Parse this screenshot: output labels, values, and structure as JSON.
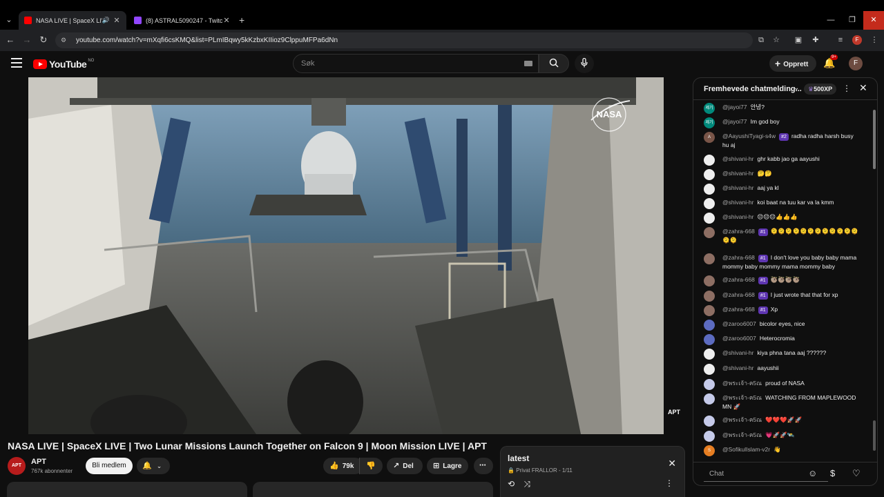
{
  "browser": {
    "tabs": [
      {
        "title": "NASA LIVE | SpaceX LIVE | Tw",
        "active": true,
        "favicon_color": "#ff0000"
      },
      {
        "title": "(8) ASTRAL5090247 - Twitch",
        "active": false,
        "favicon_color": "#9146ff"
      }
    ],
    "url": "youtube.com/watch?v=mXqfi6csKMQ&list=PLmIBqwy5kKzbxKIIioz9ClppuMFPa6dNn",
    "profile_initial": "F",
    "icons": [
      "back-icon",
      "forward-icon",
      "reload-icon",
      "site-info-icon",
      "install-icon",
      "star-icon",
      "extension-icon",
      "puzzle-icon",
      "media-icon",
      "menu-icon"
    ]
  },
  "youtube": {
    "logo_text": "YouTube",
    "country_code": "NO",
    "search_placeholder": "Søk",
    "create_label": "Opprett",
    "notifications_badge": "9+",
    "avatar_initial": "F"
  },
  "video": {
    "title": "NASA LIVE | SpaceX LIVE | Two Lunar Missions Launch Together on Falcon 9 | Moon Mission LIVE | APT",
    "watermark_logo": "NASA",
    "corner_logo": "APT"
  },
  "channel": {
    "name": "APT",
    "subscribers": "767k abonnenter",
    "avatar_text": "APT",
    "member_button": "Bli medlem"
  },
  "actions": {
    "likes": "79k",
    "share": "Del",
    "save": "Lagre"
  },
  "playlist": {
    "title": "latest",
    "privacy": "Privat",
    "owner_progress": "FRALLOR - 1/11"
  },
  "chat": {
    "header": "Fremhevede chatmelding...",
    "xp": "500XP",
    "input_placeholder": "Chat",
    "messages": [
      {
        "author": "@jayoi77",
        "badge": "",
        "text": "안녕?",
        "avatar_color": "#00897b",
        "avatar_text": "제기"
      },
      {
        "author": "@jayoi77",
        "badge": "",
        "text": "Im god boy",
        "avatar_color": "#00897b",
        "avatar_text": "제기"
      },
      {
        "author": "@AayushiTyagi-s4w",
        "badge": "#2",
        "text": "radha radha harsh busy hu aj",
        "avatar_color": "#795548",
        "avatar_text": "A"
      },
      {
        "author": "@shivani-hr",
        "badge": "",
        "text": "ghr kabb jao ga aayushi",
        "avatar_color": "#eeeeee",
        "avatar_text": ""
      },
      {
        "author": "@shivani-hr",
        "badge": "",
        "text": "🤔🤔",
        "avatar_color": "#eeeeee",
        "avatar_text": ""
      },
      {
        "author": "@shivani-hr",
        "badge": "",
        "text": "aaj ya kl",
        "avatar_color": "#eeeeee",
        "avatar_text": ""
      },
      {
        "author": "@shivani-hr",
        "badge": "",
        "text": "koi baat na tuu kar va la kmm",
        "avatar_color": "#eeeeee",
        "avatar_text": ""
      },
      {
        "author": "@shivani-hr",
        "badge": "",
        "text": "😌😌😌👍👍👍",
        "avatar_color": "#eeeeee",
        "avatar_text": ""
      },
      {
        "author": "@zahra-668",
        "badge": "#1",
        "text": "🫠🫠🫠🫠🫠🫠🫠🫠🫠🫠🫠🫠🫠🫠",
        "avatar_color": "#8d6e63",
        "avatar_text": ""
      },
      {
        "author": "@zahra-668",
        "badge": "#1",
        "text": "I don't love you baby baby mama mommy baby mommy mama mommy baby",
        "avatar_color": "#8d6e63",
        "avatar_text": ""
      },
      {
        "author": "@zahra-668",
        "badge": "#1",
        "text": "🦥🦥🦥🦥",
        "avatar_color": "#8d6e63",
        "avatar_text": ""
      },
      {
        "author": "@zahra-668",
        "badge": "#1",
        "text": "I just wrote that that for xp",
        "avatar_color": "#8d6e63",
        "avatar_text": ""
      },
      {
        "author": "@zahra-668",
        "badge": "#1",
        "text": "Xp",
        "avatar_color": "#8d6e63",
        "avatar_text": ""
      },
      {
        "author": "@zaroo6007",
        "badge": "",
        "text": "bicolor eyes, nice",
        "avatar_color": "#5c6bc0",
        "avatar_text": ""
      },
      {
        "author": "@zaroo6007",
        "badge": "",
        "text": "Heterocromia",
        "avatar_color": "#5c6bc0",
        "avatar_text": ""
      },
      {
        "author": "@shivani-hr",
        "badge": "",
        "text": "kiya phna tana aaj ??????",
        "avatar_color": "#eeeeee",
        "avatar_text": ""
      },
      {
        "author": "@shivani-hr",
        "badge": "",
        "text": "aayushii",
        "avatar_color": "#eeeeee",
        "avatar_text": ""
      },
      {
        "author": "@พระเจ้า-ค5ณ",
        "badge": "",
        "text": "proud of NASA",
        "avatar_color": "#c5cae9",
        "avatar_text": ""
      },
      {
        "author": "@พระเจ้า-ค5ณ",
        "badge": "",
        "text": "WATCHING FROM MAPLEWOOD MN 🚀",
        "avatar_color": "#c5cae9",
        "avatar_text": ""
      },
      {
        "author": "@พระเจ้า-ค5ณ",
        "badge": "",
        "text": "❤️❤️❤️🚀🚀",
        "avatar_color": "#c5cae9",
        "avatar_text": ""
      },
      {
        "author": "@พระเจ้า-ค5ณ",
        "badge": "",
        "text": "💗🚀🚀🛰️",
        "avatar_color": "#c5cae9",
        "avatar_text": ""
      },
      {
        "author": "@SofikulIslam-v2r",
        "badge": "",
        "text": "👋",
        "avatar_color": "#e67e22",
        "avatar_text": "S"
      }
    ]
  }
}
